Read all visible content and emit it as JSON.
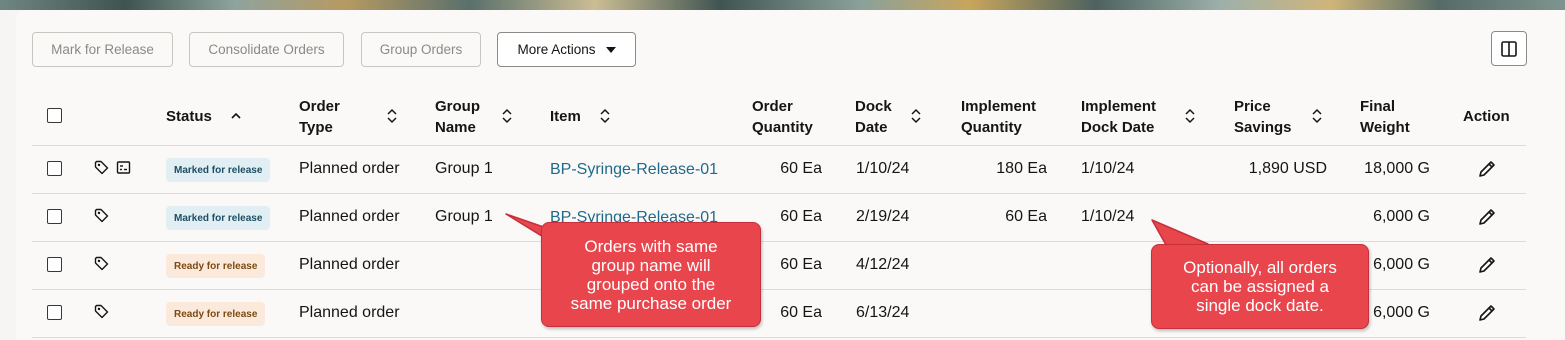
{
  "toolbar": {
    "mark_for_release": "Mark for Release",
    "consolidate_orders": "Consolidate Orders",
    "group_orders": "Group Orders",
    "more_actions": "More Actions"
  },
  "columns": {
    "status": "Status",
    "order_type": [
      "Order",
      "Type"
    ],
    "group_name": [
      "Group",
      "Name"
    ],
    "item": "Item",
    "order_quantity": [
      "Order",
      "Quantity"
    ],
    "dock_date": [
      "Dock",
      "Date"
    ],
    "implement_quantity": [
      "Implement",
      "Quantity"
    ],
    "implement_dock_date": [
      "Implement",
      "Dock Date"
    ],
    "price_savings": [
      "Price",
      "Savings"
    ],
    "final_weight": [
      "Final",
      "Weight"
    ],
    "action": "Action"
  },
  "rows": [
    {
      "status": "Marked for release",
      "order_type": "Planned order",
      "group_name": "Group 1",
      "item": "BP-Syringe-Release-01",
      "order_quantity": "60 Ea",
      "dock_date": "1/10/24",
      "implement_quantity": "180 Ea",
      "implement_dock_date": "1/10/24",
      "price_savings": "1,890 USD",
      "final_weight": "18,000 G"
    },
    {
      "status": "Marked for release",
      "order_type": "Planned order",
      "group_name": "Group 1",
      "item": "BP-Syringe-Release-01",
      "order_quantity": "60 Ea",
      "dock_date": "2/19/24",
      "implement_quantity": "60 Ea",
      "implement_dock_date": "1/10/24",
      "price_savings": "",
      "final_weight": "6,000 G"
    },
    {
      "status": "Ready for release",
      "order_type": "Planned order",
      "group_name": "",
      "item": "",
      "order_quantity": "60 Ea",
      "dock_date": "4/12/24",
      "implement_quantity": "",
      "implement_dock_date": "",
      "price_savings": "",
      "final_weight": "6,000 G"
    },
    {
      "status": "Ready for release",
      "order_type": "Planned order",
      "group_name": "",
      "item": "",
      "order_quantity": "60 Ea",
      "dock_date": "6/13/24",
      "implement_quantity": "",
      "implement_dock_date": "",
      "price_savings": "",
      "final_weight": "6,000 G"
    }
  ],
  "callouts": {
    "group": [
      "Orders with same",
      "group name will",
      "grouped onto the",
      "same purchase order"
    ],
    "dock": [
      "Optionally, all orders",
      "can be assigned a",
      "single dock date."
    ]
  },
  "colors": {
    "callout": "#e8454c",
    "link": "#1f6a8a",
    "badge_marked": "#e1eff4",
    "badge_ready": "#fbeadb"
  },
  "icons": [
    "tag-icon",
    "group-icon",
    "pencil-icon",
    "panel-toggle-icon",
    "sort-icon",
    "sort-ascending-icon",
    "chevron-down-icon"
  ]
}
